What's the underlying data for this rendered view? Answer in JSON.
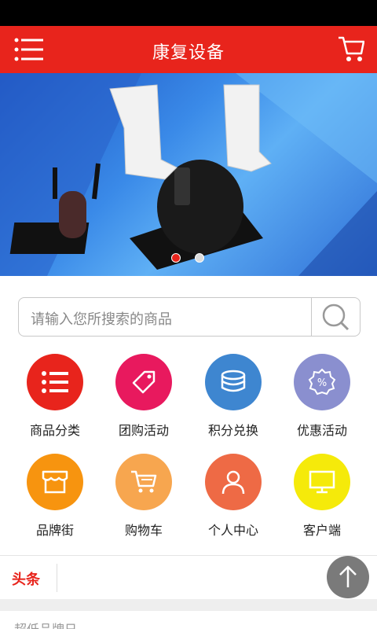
{
  "header": {
    "title": "康复设备"
  },
  "search": {
    "placeholder": "请输入您所搜索的商品"
  },
  "grid": [
    {
      "label": "商品分类",
      "color": "#e8241c",
      "icon": "list-icon"
    },
    {
      "label": "团购活动",
      "color": "#e8195e",
      "icon": "tag-icon"
    },
    {
      "label": "积分兑换",
      "color": "#3e86d0",
      "icon": "coins-icon"
    },
    {
      "label": "优惠活动",
      "color": "#8a8fcf",
      "icon": "percent-badge-icon"
    },
    {
      "label": "品牌街",
      "color": "#f7940f",
      "icon": "shop-icon"
    },
    {
      "label": "购物车",
      "color": "#f7a64f",
      "icon": "cart-icon"
    },
    {
      "label": "个人中心",
      "color": "#ee6a45",
      "icon": "user-icon"
    },
    {
      "label": "客户端",
      "color": "#f5ea0a",
      "icon": "monitor-icon"
    }
  ],
  "news": {
    "tag": "头条"
  },
  "bottom": {
    "text": "超低品牌日"
  },
  "colors": {
    "brand": "#e8241c"
  }
}
